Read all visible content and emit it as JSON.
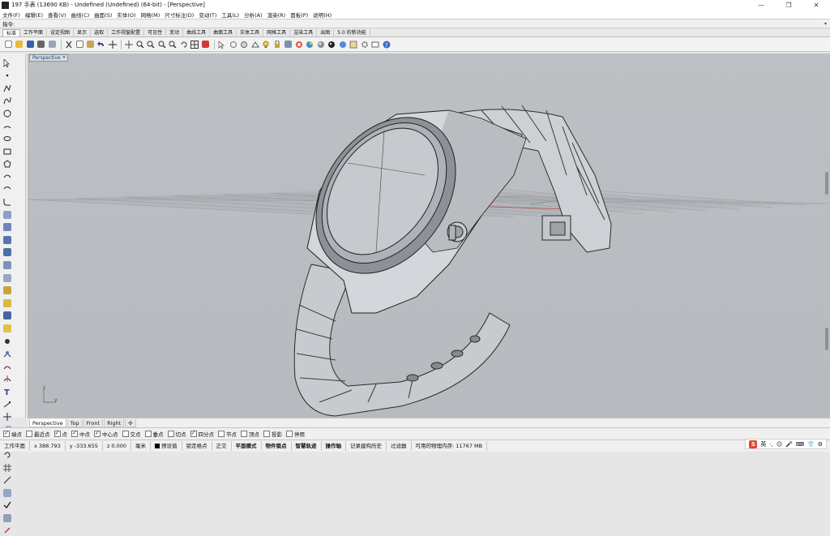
{
  "window": {
    "title": "197 手表 (13690 KB) - Undefined (Undefined) (64-bit) - [Perspective]",
    "min": "—",
    "restore": "❐",
    "close": "✕"
  },
  "menu": [
    "文件(F)",
    "编辑(E)",
    "查看(V)",
    "曲线(C)",
    "曲面(S)",
    "实体(O)",
    "网格(M)",
    "尺寸标注(D)",
    "变动(T)",
    "工具(L)",
    "分析(A)",
    "渲染(R)",
    "面板(P)",
    "说明(H)"
  ],
  "command": {
    "label": "指令:",
    "dropdown": "▾"
  },
  "tabs": [
    "标准",
    "工作平面",
    "设定视图",
    "显示",
    "选取",
    "工作视窗配置",
    "可见性",
    "变动",
    "曲线工具",
    "曲面工具",
    "实体工具",
    "网格工具",
    "渲染工具",
    "出图",
    "5.0 的新功能"
  ],
  "viewport": {
    "label": "Perspective",
    "caret": "▾",
    "axis_y": "y",
    "axis_z": "z"
  },
  "view_tabs": [
    "Perspective",
    "Top",
    "Front",
    "Right",
    "✣"
  ],
  "osnaps": [
    {
      "label": "端点",
      "on": true
    },
    {
      "label": "最近点",
      "on": false
    },
    {
      "label": "点",
      "on": true
    },
    {
      "label": "中点",
      "on": true
    },
    {
      "label": "中心点",
      "on": true
    },
    {
      "label": "交点",
      "on": false
    },
    {
      "label": "垂点",
      "on": false
    },
    {
      "label": "切点",
      "on": false
    },
    {
      "label": "四分点",
      "on": true
    },
    {
      "label": "节点",
      "on": false
    },
    {
      "label": "顶点",
      "on": false
    },
    {
      "label": "投影",
      "on": false
    },
    {
      "label": "停用",
      "on": false
    }
  ],
  "status": {
    "cplane": "工作平面",
    "x": "x 388.793",
    "y": "y -333.655",
    "z": "z 0.000",
    "units": "毫米",
    "layer": "预设值",
    "lock_grid": "锁定格点",
    "ortho": "正交",
    "planar": "平面模式",
    "osnap": "物件锁点",
    "smarttrack": "智慧轨迹",
    "gumball": "操作轴",
    "history": "记录建构历史",
    "filter": "过滤器",
    "memory": "可用的物理内存: 11767 MB"
  },
  "ime": {
    "logo": "S",
    "lang": "英",
    "icons": [
      "·,",
      "☺",
      "🎤",
      "⌨",
      "👕",
      "⚙"
    ]
  },
  "colors": {
    "viewport_bg": "#b9bcc1",
    "label_text": "#1a3f7a",
    "grid": "#8e9196",
    "x_axis": "#b5524c",
    "y_axis": "#5fa55a"
  }
}
